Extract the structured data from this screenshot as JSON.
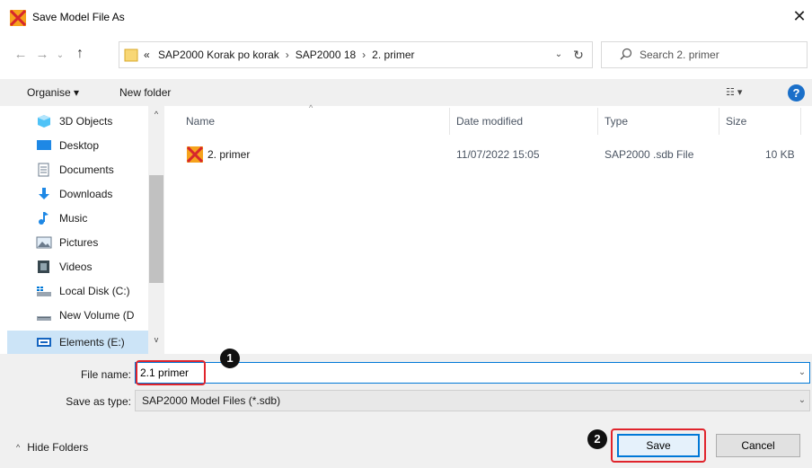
{
  "window": {
    "title": "Save Model File As",
    "close_glyph": "✕"
  },
  "address_bar": {
    "back_glyph": "←",
    "forward_glyph": "→",
    "recent_glyph": "⌄",
    "up_glyph": "↑",
    "overflow_glyph": "«",
    "breadcrumbs": [
      "SAP2000 Korak po korak",
      "SAP2000 18",
      "2. primer"
    ],
    "separator": "›",
    "dropdown_glyph": "⌄",
    "refresh_glyph": "↻"
  },
  "search": {
    "placeholder": "Search 2. primer"
  },
  "toolbar": {
    "organise_label": "Organise ▾",
    "new_folder_label": "New folder",
    "view_glyph": "☷ ▾",
    "help_glyph": "?"
  },
  "sidebar": {
    "items": [
      {
        "label": "3D Objects",
        "icon": "3d-objects-icon"
      },
      {
        "label": "Desktop",
        "icon": "desktop-icon"
      },
      {
        "label": "Documents",
        "icon": "documents-icon"
      },
      {
        "label": "Downloads",
        "icon": "downloads-icon"
      },
      {
        "label": "Music",
        "icon": "music-icon"
      },
      {
        "label": "Pictures",
        "icon": "pictures-icon"
      },
      {
        "label": "Videos",
        "icon": "videos-icon"
      },
      {
        "label": "Local Disk (C:)",
        "icon": "local-disk-icon"
      },
      {
        "label": "New Volume (D",
        "icon": "drive-icon"
      },
      {
        "label": "Elements (E:)",
        "icon": "wd-drive-icon",
        "selected": true
      }
    ],
    "scroll_up_glyph": "^",
    "scroll_down_glyph": "v"
  },
  "file_list": {
    "columns": {
      "name": "Name",
      "date": "Date modified",
      "type": "Type",
      "size": "Size"
    },
    "sort_glyph": "^",
    "rows": [
      {
        "name": "2. primer",
        "date": "11/07/2022 15:05",
        "type": "SAP2000 .sdb File",
        "size": "10 KB",
        "icon": "sap2000-file-icon"
      }
    ]
  },
  "form": {
    "file_name_label": "File name:",
    "file_name_value": "2.1 primer",
    "save_as_type_label": "Save as type:",
    "save_as_type_value": "SAP2000 Model Files (*.sdb)",
    "dropdown_glyph": "⌄"
  },
  "footer": {
    "hide_folders_glyph": "^",
    "hide_folders_label": "Hide Folders",
    "save_label": "Save",
    "cancel_label": "Cancel"
  },
  "annotations": {
    "badge_1": "1",
    "badge_2": "2",
    "highlight_color": "#e0242c"
  },
  "colors": {
    "accent": "#0078d7",
    "selection": "#cce4f7",
    "app_icon_orange": "#f39c12",
    "app_icon_red": "#d6262c"
  }
}
